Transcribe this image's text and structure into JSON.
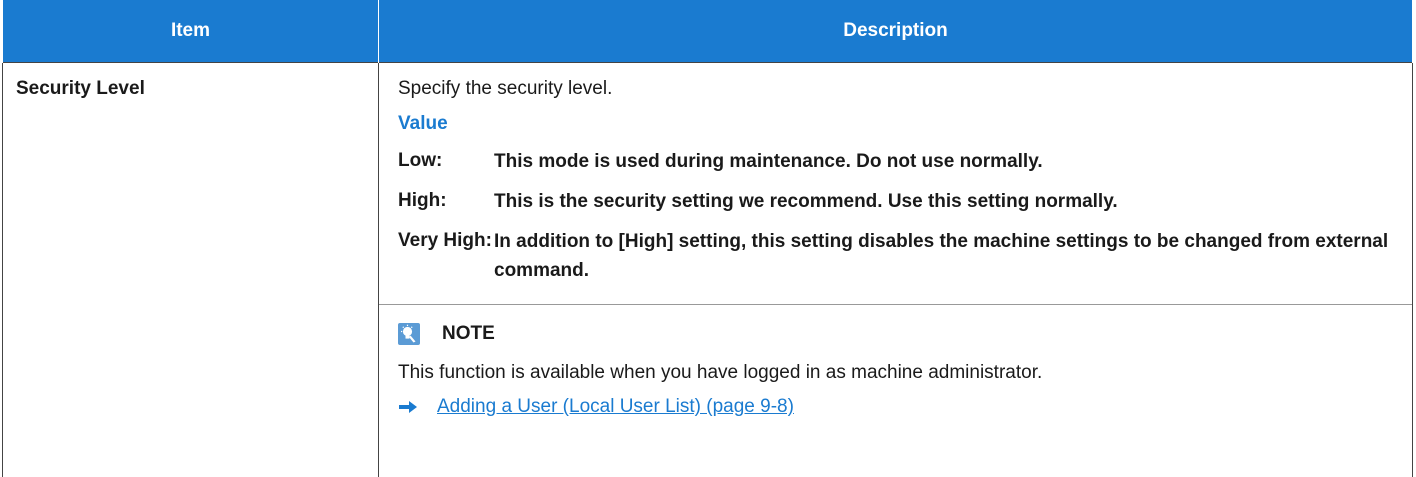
{
  "table": {
    "headers": {
      "item": "Item",
      "description": "Description"
    },
    "row": {
      "item": "Security Level",
      "intro": "Specify the security level.",
      "value_heading": "Value",
      "values": [
        {
          "label": "Low:",
          "text": "This mode is used during maintenance. Do not use normally."
        },
        {
          "label": "High:",
          "text": "This is the security setting we recommend. Use this setting normally."
        },
        {
          "label": "Very High:",
          "text": "In addition to [High] setting, this setting disables the machine settings to be changed from external command."
        }
      ],
      "note": {
        "label": "NOTE",
        "text": "This function is available when you have logged in as machine administrator.",
        "link": "Adding a User (Local User List) (page 9-8)"
      }
    }
  },
  "colors": {
    "header_bg": "#1a7bd0",
    "accent": "#1a7bd0",
    "note_icon": "#5b9bd5"
  },
  "icons": {
    "note": "note-lightbulb-icon",
    "link": "arrow-right-icon"
  }
}
